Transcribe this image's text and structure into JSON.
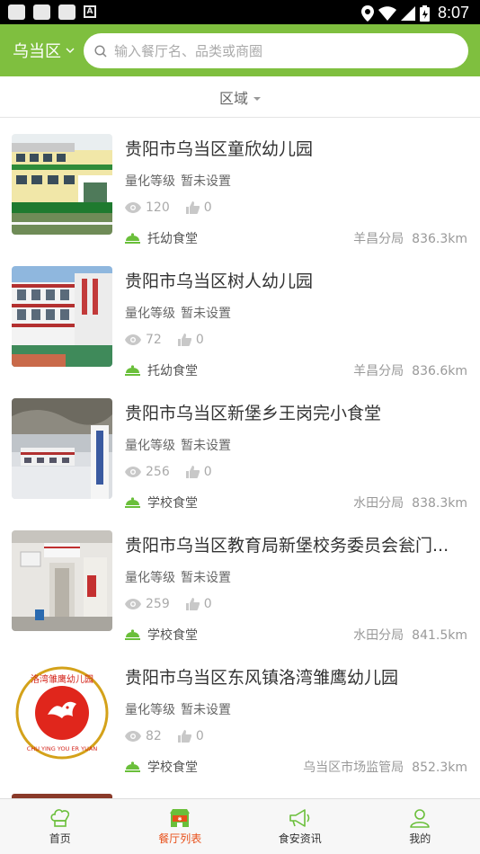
{
  "status_bar": {
    "time": "8:07"
  },
  "header": {
    "region": "乌当区",
    "search_placeholder": "输入餐厅名、品类或商圈"
  },
  "filter": {
    "label": "区域"
  },
  "restaurants": [
    {
      "name": "贵阳市乌当区童欣幼儿园",
      "grade_label": "量化等级",
      "grade_value": "暂未设置",
      "views": "120",
      "likes": "0",
      "category": "托幼食堂",
      "bureau": "羊昌分局",
      "distance": "836.3km"
    },
    {
      "name": "贵阳市乌当区树人幼儿园",
      "grade_label": "量化等级",
      "grade_value": "暂未设置",
      "views": "72",
      "likes": "0",
      "category": "托幼食堂",
      "bureau": "羊昌分局",
      "distance": "836.6km"
    },
    {
      "name": "贵阳市乌当区新堡乡王岗完小食堂",
      "grade_label": "量化等级",
      "grade_value": "暂未设置",
      "views": "256",
      "likes": "0",
      "category": "学校食堂",
      "bureau": "水田分局",
      "distance": "838.3km"
    },
    {
      "name": "贵阳市乌当区教育局新堡校务委员会瓮门...",
      "grade_label": "量化等级",
      "grade_value": "暂未设置",
      "views": "259",
      "likes": "0",
      "category": "学校食堂",
      "bureau": "水田分局",
      "distance": "841.5km"
    },
    {
      "name": "贵阳市乌当区东风镇洛湾雏鹰幼儿园",
      "grade_label": "量化等级",
      "grade_value": "暂未设置",
      "views": "82",
      "likes": "0",
      "category": "学校食堂",
      "bureau": "乌当区市场监管局",
      "distance": "852.3km"
    }
  ],
  "logo_text": {
    "top": "洛湾雏鹰幼儿园",
    "bottom": "CHU YING YOU ER YUAN"
  },
  "tabs": [
    {
      "label": "首页",
      "icon": "chef-hat-icon"
    },
    {
      "label": "餐厅列表",
      "icon": "storefront-icon",
      "active": true
    },
    {
      "label": "食安资讯",
      "icon": "megaphone-icon"
    },
    {
      "label": "我的",
      "icon": "person-icon"
    }
  ],
  "colors": {
    "brand_green": "#7fbf3f",
    "active_tab": "#e8501a",
    "category_icon": "#6abf3a"
  }
}
